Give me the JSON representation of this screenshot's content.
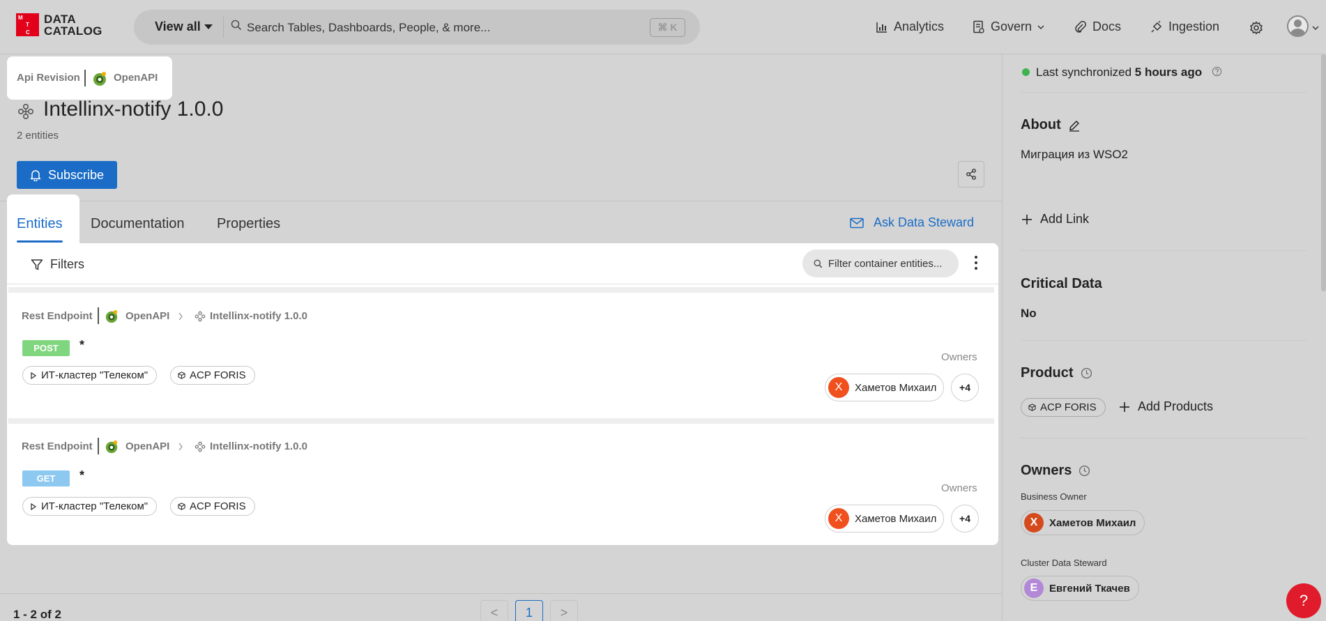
{
  "header": {
    "logo_letters": [
      "M",
      "T",
      "C"
    ],
    "logo_line1": "DATA",
    "logo_line2": "CATALOG",
    "view_all": "View all",
    "search_placeholder": "Search Tables, Dashboards, People, & more...",
    "shortcut": "⌘ K",
    "nav": [
      "Analytics",
      "Govern",
      "Docs",
      "Ingestion"
    ]
  },
  "breadcrumb": {
    "type": "Api Revision",
    "service": "OpenAPI"
  },
  "entity": {
    "title": "Intellinx-notify 1.0.0",
    "count": "2 entities",
    "subscribe_label": "Subscribe"
  },
  "tabs": {
    "items": [
      "Entities",
      "Documentation",
      "Properties"
    ],
    "active": "Entities",
    "ask_steward": "Ask Data Steward"
  },
  "toolbar": {
    "filters_label": "Filters",
    "filter_placeholder": "Filter container entities..."
  },
  "endpoints": [
    {
      "type": "Rest Endpoint",
      "service": "OpenAPI",
      "parent": "Intellinx-notify 1.0.0",
      "method": "POST",
      "method_color": "#7fd67f",
      "name": "*",
      "tags": [
        "ИТ-кластер \"Телеком\"",
        "ACP FORIS"
      ],
      "owners_label": "Owners",
      "owner_initial": "X",
      "owner_name": "Хаметов Михаил",
      "owners_more": "+4"
    },
    {
      "type": "Rest Endpoint",
      "service": "OpenAPI",
      "parent": "Intellinx-notify 1.0.0",
      "method": "GET",
      "method_color": "#8cc8f0",
      "name": "*",
      "tags": [
        "ИТ-кластер \"Телеком\"",
        "ACP FORIS"
      ],
      "owners_label": "Owners",
      "owner_initial": "X",
      "owner_name": "Хаметов Михаил",
      "owners_more": "+4"
    }
  ],
  "pagination": {
    "range": "1 - 2 of 2",
    "prev": "<",
    "current": "1",
    "next": ">"
  },
  "sidebar": {
    "sync_prefix": "Last synchronized",
    "sync_value": "5 hours ago",
    "about_heading": "About",
    "about_text": "Миграция из WSO2",
    "add_link": "Add Link",
    "critical_heading": "Critical Data",
    "critical_value": "No",
    "product_heading": "Product",
    "product_tag": "ACP FORIS",
    "add_products": "Add Products",
    "owners_heading": "Owners",
    "business_owner_label": "Business Owner",
    "business_owner_initial": "X",
    "business_owner_name": "Хаметов Михаил",
    "steward_label": "Cluster Data Steward",
    "steward_initial": "E",
    "steward_name": "Евгений Ткачев"
  },
  "colors": {
    "accent": "#1a6cc6",
    "brand_red": "#e3001b",
    "sync_green": "#3cb44b",
    "owner_orange": "#f0501e",
    "steward_purple": "#b388d6"
  },
  "help_label": "?"
}
